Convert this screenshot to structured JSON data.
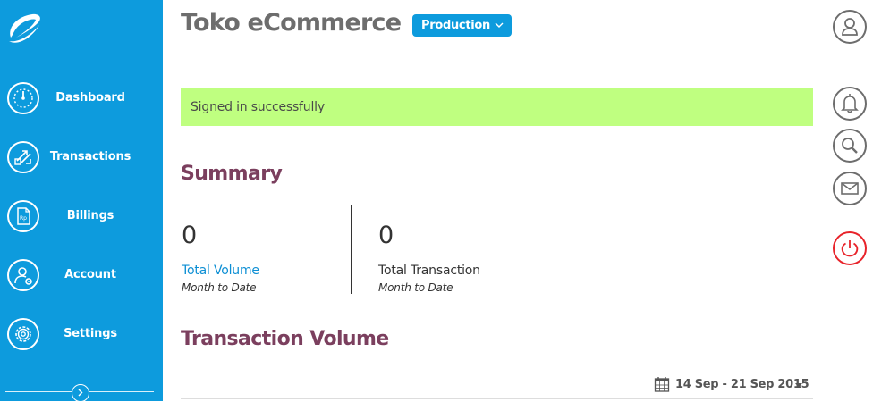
{
  "sidebar": {
    "logo": "brand-swoosh-logo",
    "items": [
      {
        "label": "Dashboard",
        "icon": "gauge-icon"
      },
      {
        "label": "Transactions",
        "icon": "exchange-arrows-icon"
      },
      {
        "label": "Billings",
        "icon": "rupiah-document-icon"
      },
      {
        "label": "Account",
        "icon": "user-gear-icon"
      },
      {
        "label": "Settings",
        "icon": "gear-icon"
      }
    ],
    "collapse_icon": "chevron-right-icon"
  },
  "header": {
    "title": "Toko eCommerce",
    "environment": {
      "selected": "Production",
      "icon": "chevron-down-icon"
    }
  },
  "alert": {
    "message": "Signed in successfully",
    "color": "#bfff80"
  },
  "summary": {
    "title": "Summary",
    "stats": [
      {
        "value": "0",
        "label": "Total Volume",
        "period": "Month to Date"
      },
      {
        "value": "0",
        "label": "Total Transaction",
        "period": "Month to Date"
      }
    ]
  },
  "transaction_volume": {
    "title": "Transaction Volume",
    "date_range": "14 Sep - 21 Sep 2015",
    "calendar_icon": "calendar-icon",
    "caret_icon": "caret-down-icon"
  },
  "rail": {
    "icons": [
      "user-profile-icon",
      "bell-icon",
      "search-icon",
      "mail-icon",
      "power-icon"
    ]
  },
  "colors": {
    "primary": "#0d9bdd",
    "heading": "#7b3f5e",
    "title_gray": "#6d6d6d",
    "logout_red": "#e8232a",
    "link": "#0d8fd4"
  }
}
